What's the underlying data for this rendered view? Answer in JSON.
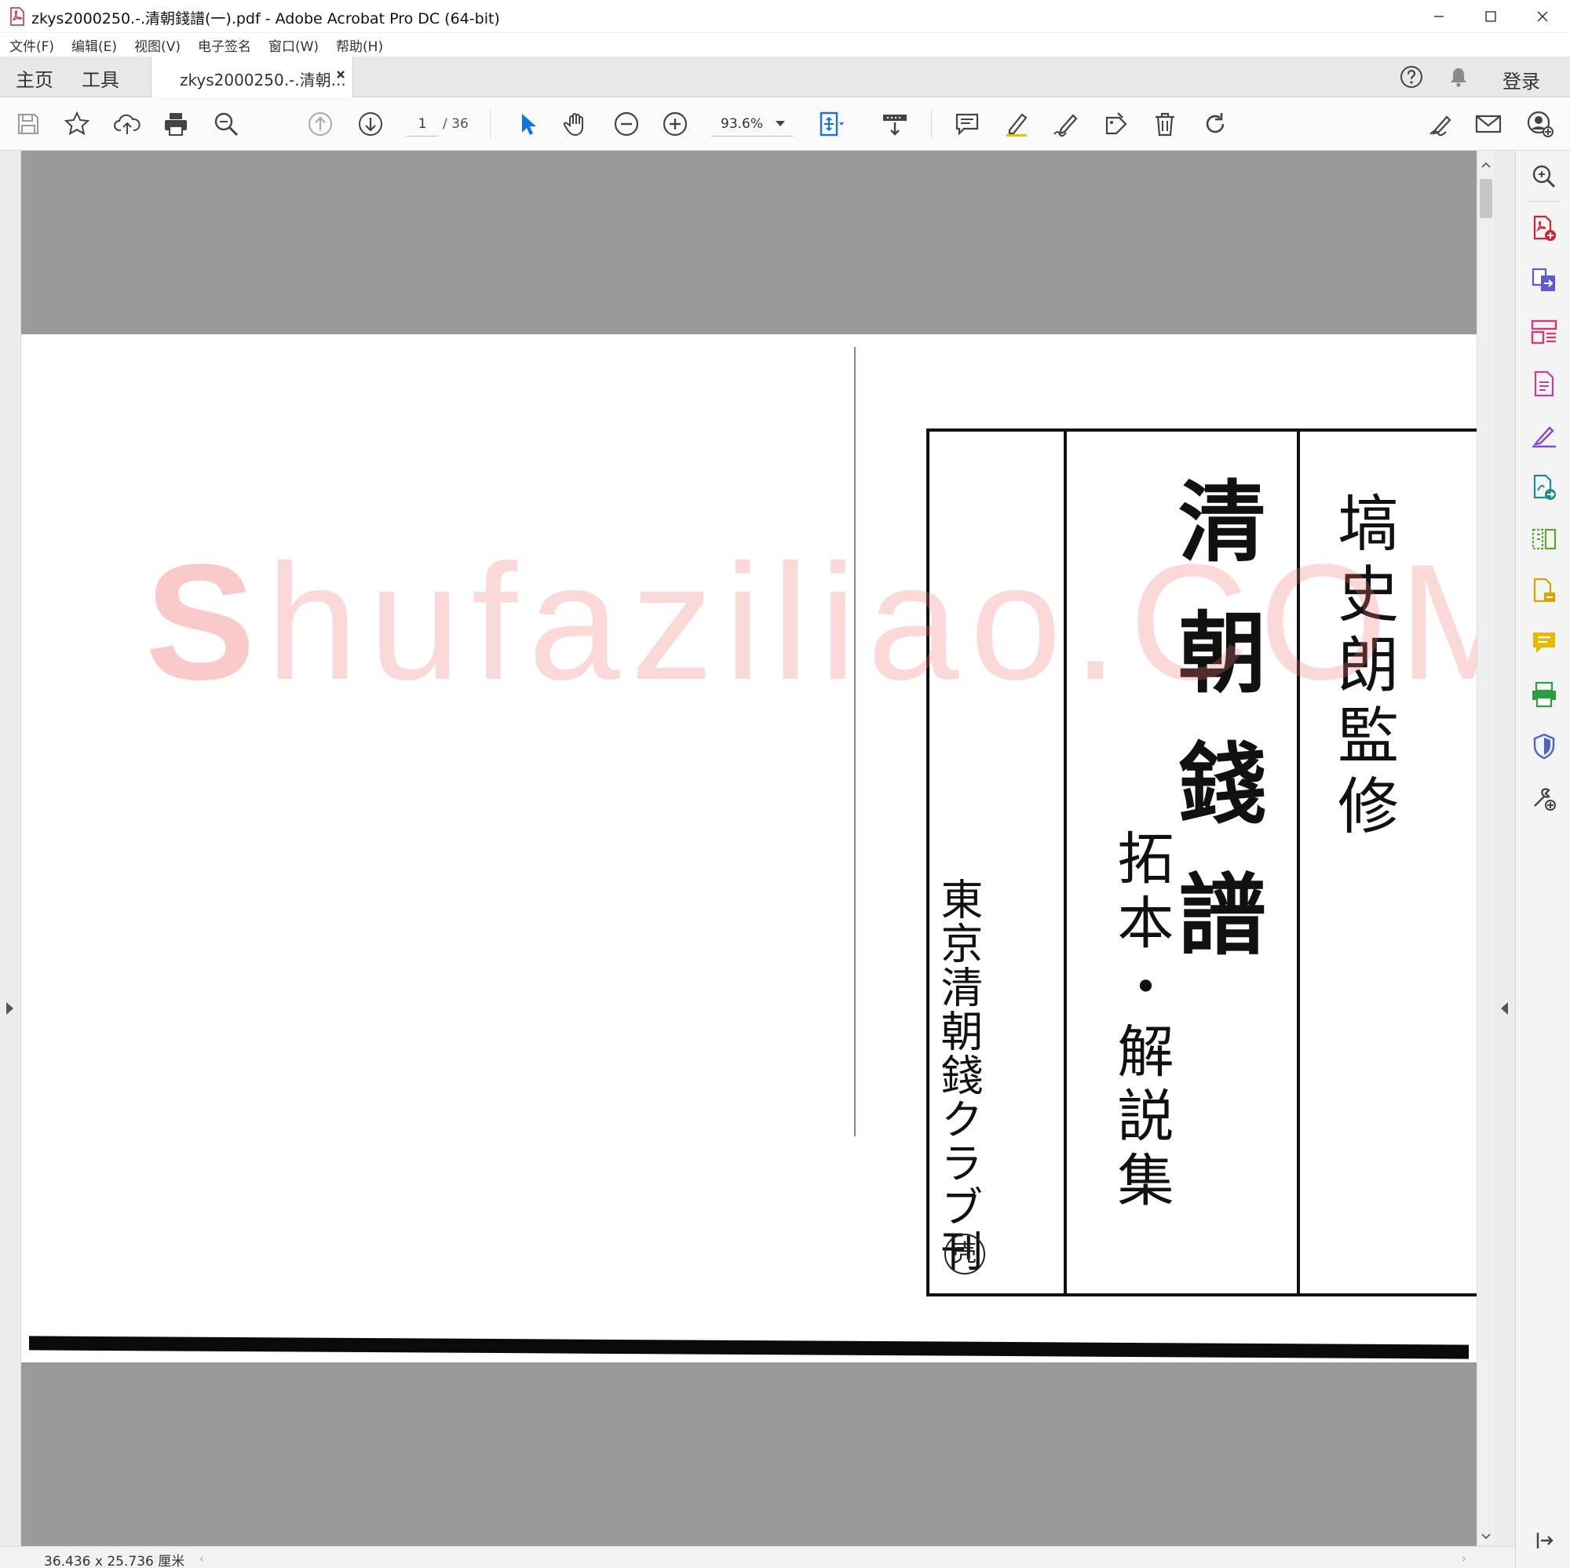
{
  "window": {
    "title": "zkys2000250.-.清朝錢譜(一).pdf - Adobe Acrobat Pro DC (64-bit)"
  },
  "menu": [
    "文件(F)",
    "编辑(E)",
    "视图(V)",
    "电子签名",
    "窗口(W)",
    "帮助(H)"
  ],
  "tabs": {
    "home": "主页",
    "tools": "工具",
    "document": "zkys2000250.-.清朝...",
    "login": "登录"
  },
  "toolbar": {
    "page_current": "1",
    "page_total": "/ 36",
    "zoom": "93.6%"
  },
  "status": {
    "page_size": "36.436 x 25.736 厘米"
  },
  "document_page": {
    "title_main": "清朝錢譜",
    "title_side": "塙史朗監修",
    "subtitle": "拓本・解説集",
    "publisher": "東京清朝錢クラブ刊",
    "seal": "壳",
    "watermark_initial": "S",
    "watermark_rest": "hufaziliao.COM"
  },
  "colors": {
    "acrobat_red": "#d4232c",
    "select_blue": "#1473e6",
    "viewer_gray": "#9a9a9a"
  },
  "icons": {
    "toolbar": [
      "save-icon",
      "bookmark-star-icon",
      "upload-cloud-icon",
      "print-icon",
      "zoom-search-icon",
      "prev-page-icon",
      "next-page-icon",
      "select-arrow-icon",
      "hand-icon",
      "zoom-out-icon",
      "zoom-in-icon",
      "fit-page-icon",
      "scroll-mode-icon",
      "comment-icon",
      "highlight-pen-icon",
      "sign-pen-icon",
      "stamp-icon",
      "delete-icon",
      "rotate-icon",
      "fill-sign-icon",
      "email-icon",
      "add-user-icon"
    ],
    "right_pane": [
      "search-zoom-icon",
      "create-pdf-icon",
      "export-pdf-icon",
      "organize-pages-icon",
      "edit-pdf-icon",
      "fill-sign-icon",
      "request-signature-icon",
      "compare-icon",
      "export-file-icon",
      "comment-icon",
      "scan-icon",
      "protect-icon",
      "more-tools-icon",
      "collapse-pane-icon"
    ]
  }
}
